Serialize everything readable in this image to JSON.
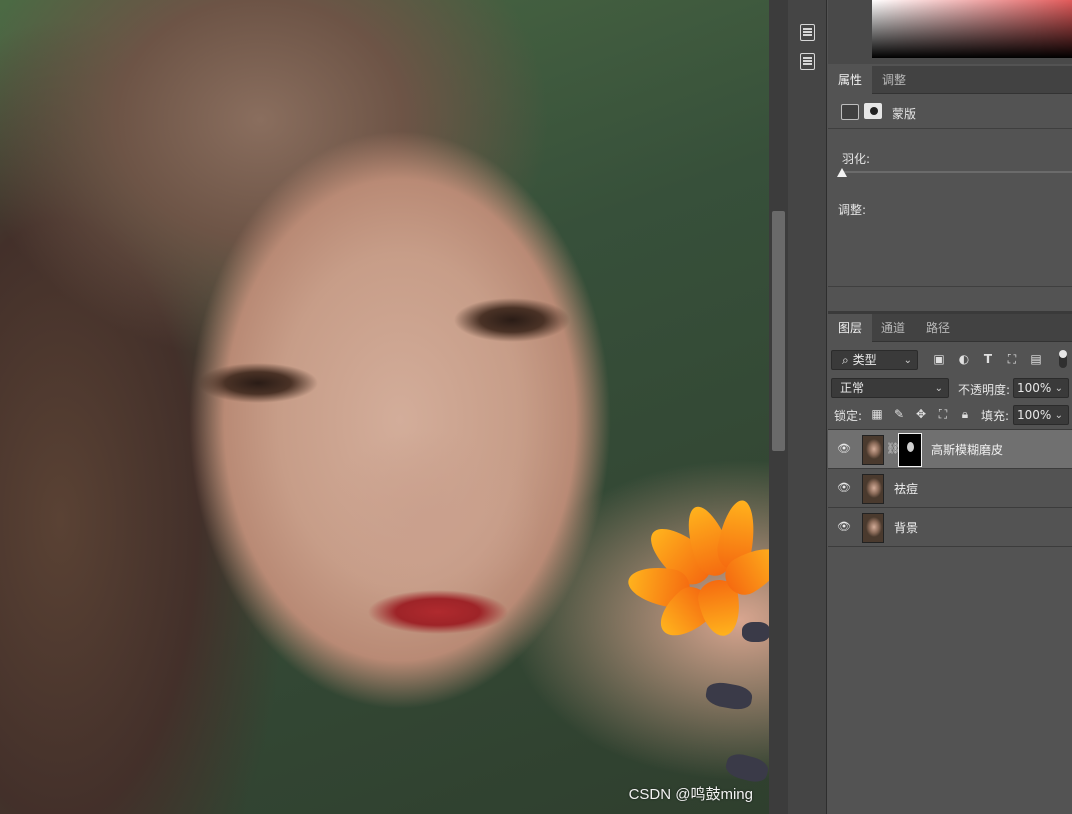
{
  "properties_panel": {
    "tabs": [
      "属性",
      "调整"
    ],
    "active_tab": "属性",
    "mask_label": "蒙版",
    "feather_label": "羽化:",
    "adjust_label": "调整:"
  },
  "layers_panel": {
    "tabs": [
      "图层",
      "通道",
      "路径"
    ],
    "active_tab": "图层",
    "filter_kind": "类型",
    "blend_mode": "正常",
    "opacity_label": "不透明度:",
    "opacity_value": "100%",
    "lock_label": "锁定:",
    "fill_label": "填充:",
    "fill_value": "100%",
    "layers": [
      {
        "name": "高斯模糊磨皮",
        "selected": true,
        "has_mask": true
      },
      {
        "name": "祛痘",
        "selected": false,
        "has_mask": false
      },
      {
        "name": "背景",
        "selected": false,
        "has_mask": false
      }
    ]
  },
  "watermark": "CSDN @鸣鼓ming",
  "colors": {
    "panel_bg": "#535353",
    "tab_bar": "#424242",
    "selected_layer": "#707070",
    "flower": "#f57a10",
    "lips": "#a82a2e"
  },
  "icons": [
    "eye-icon",
    "link-icon",
    "layer-thumbnail",
    "mask-thumbnail",
    "filter-pixel-icon",
    "filter-adjustment-icon",
    "filter-type-icon",
    "filter-shape-icon",
    "filter-smart-icon",
    "lock-transparent-icon",
    "lock-paint-icon",
    "lock-move-icon",
    "lock-artboard-icon",
    "lock-all-icon"
  ]
}
